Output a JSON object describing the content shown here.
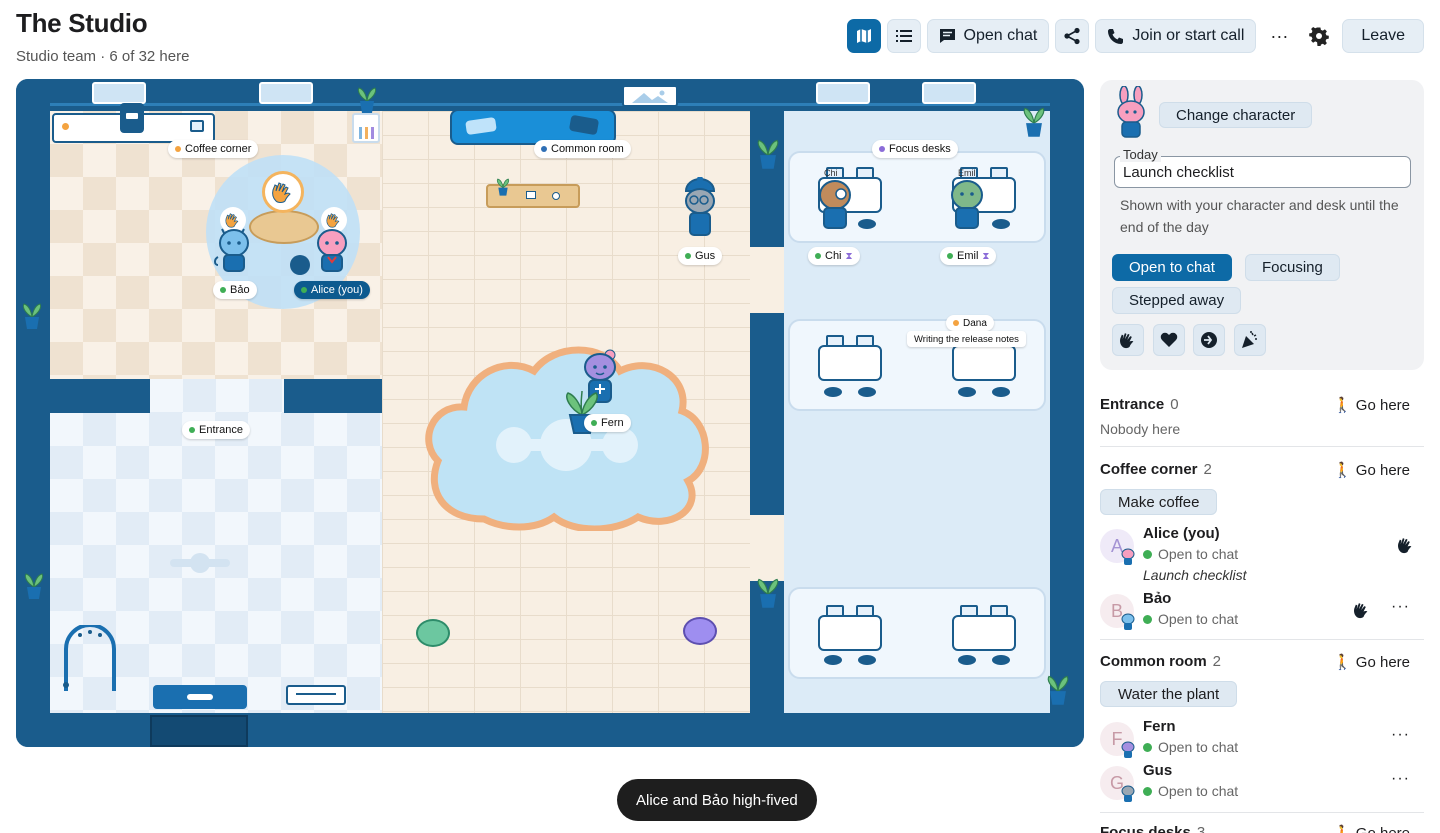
{
  "header": {
    "title": "The Studio",
    "subtitle": "Studio team · 6 of 32 here",
    "open_chat": "Open chat",
    "join_call": "Join or start call",
    "more": "···",
    "leave": "Leave"
  },
  "map": {
    "labels": {
      "coffee_corner": "Coffee corner",
      "common_room": "Common room",
      "focus_desks": "Focus desks",
      "entrance": "Entrance",
      "gus": "Gus",
      "chi": "Chi",
      "emil": "Emil",
      "chi_tag": "Chi",
      "emil_tag": "Emil",
      "bao": "Bảo",
      "alice": "Alice (you)",
      "dana": "Dana",
      "dana_note": "Writing the release notes",
      "fern": "Fern"
    },
    "colors": {
      "coffee_dot": "#f4a340",
      "common_dot": "#2f6fb5",
      "focus_dot": "#8b6cd8",
      "entrance_dot": "#3fae55",
      "online": "#3fae55",
      "away": "#f4a340"
    }
  },
  "toast": "Alice and Bảo high-fived",
  "status_card": {
    "change_character": "Change character",
    "today_label": "Today",
    "today_value": "Launch checklist",
    "helper": "Shown with your character and desk until the end of the day",
    "statuses": [
      "Open to chat",
      "Focusing",
      "Stepped away"
    ],
    "reactions": [
      "high-five-icon",
      "heart-icon",
      "fist-bump-icon",
      "party-icon"
    ]
  },
  "rooms": [
    {
      "name": "Entrance",
      "count": "0",
      "go": "Go here",
      "empty": "Nobody here"
    },
    {
      "name": "Coffee corner",
      "count": "2",
      "go": "Go here",
      "action": "Make coffee",
      "people": [
        {
          "initial": "A",
          "name": "Alice (you)",
          "status": "Open to chat",
          "note": "Launch checklist"
        },
        {
          "initial": "B",
          "name": "Bảo",
          "status": "Open to chat"
        }
      ]
    },
    {
      "name": "Common room",
      "count": "2",
      "go": "Go here",
      "action": "Water the plant",
      "people": [
        {
          "initial": "F",
          "name": "Fern",
          "status": "Open to chat"
        },
        {
          "initial": "G",
          "name": "Gus",
          "status": "Open to chat"
        }
      ]
    },
    {
      "name": "Focus desks",
      "count": "3",
      "go": "Go here"
    }
  ]
}
